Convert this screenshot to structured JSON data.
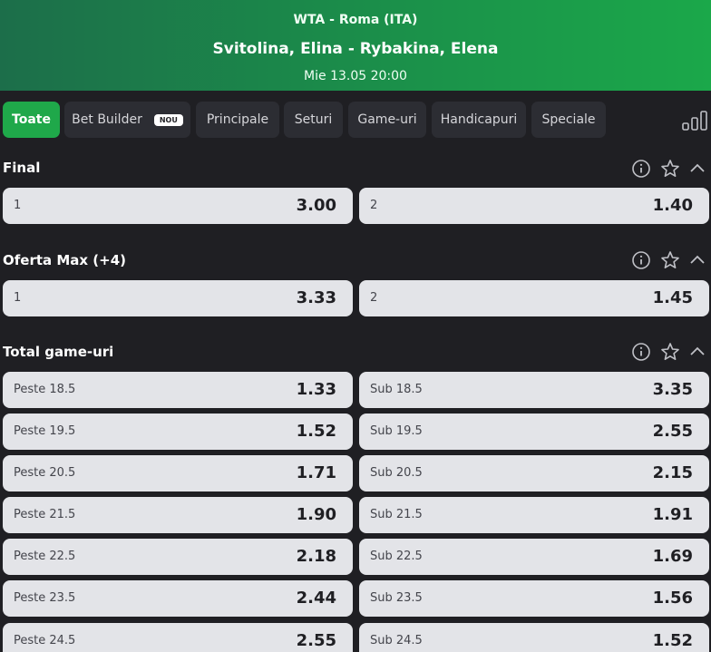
{
  "header": {
    "competition": "WTA - Roma (ITA)",
    "match": "Svitolina, Elina - Rybakina, Elena",
    "datetime": "Mie 13.05 20:00"
  },
  "tabs": [
    {
      "label": "Toate",
      "active": true
    },
    {
      "label": "Bet Builder",
      "badge": "NOU"
    },
    {
      "label": "Principale"
    },
    {
      "label": "Seturi"
    },
    {
      "label": "Game-uri"
    },
    {
      "label": "Handicapuri"
    },
    {
      "label": "Speciale"
    }
  ],
  "sections": [
    {
      "title": "Final",
      "odds": [
        {
          "label": "1",
          "value": "3.00"
        },
        {
          "label": "2",
          "value": "1.40"
        }
      ]
    },
    {
      "title": "Oferta Max (+4)",
      "odds": [
        {
          "label": "1",
          "value": "3.33"
        },
        {
          "label": "2",
          "value": "1.45"
        }
      ]
    },
    {
      "title": "Total game-uri",
      "rows": [
        [
          {
            "label": "Peste 18.5",
            "value": "1.33"
          },
          {
            "label": "Sub 18.5",
            "value": "3.35"
          }
        ],
        [
          {
            "label": "Peste 19.5",
            "value": "1.52"
          },
          {
            "label": "Sub 19.5",
            "value": "2.55"
          }
        ],
        [
          {
            "label": "Peste 20.5",
            "value": "1.71"
          },
          {
            "label": "Sub 20.5",
            "value": "2.15"
          }
        ],
        [
          {
            "label": "Peste 21.5",
            "value": "1.90"
          },
          {
            "label": "Sub 21.5",
            "value": "1.91"
          }
        ],
        [
          {
            "label": "Peste 22.5",
            "value": "2.18"
          },
          {
            "label": "Sub 22.5",
            "value": "1.69"
          }
        ],
        [
          {
            "label": "Peste 23.5",
            "value": "2.44"
          },
          {
            "label": "Sub 23.5",
            "value": "1.56"
          }
        ],
        [
          {
            "label": "Peste 24.5",
            "value": "2.55"
          },
          {
            "label": "Sub 24.5",
            "value": "1.52"
          }
        ]
      ]
    }
  ],
  "icons": {
    "info": "info-icon",
    "favorite": "star-icon",
    "collapse": "chevron-up-icon",
    "stats": "stats-bars-icon"
  },
  "colors": {
    "accent": "#1fa84a",
    "background": "#1f1f23",
    "odd_button": "#e3e4e8"
  }
}
